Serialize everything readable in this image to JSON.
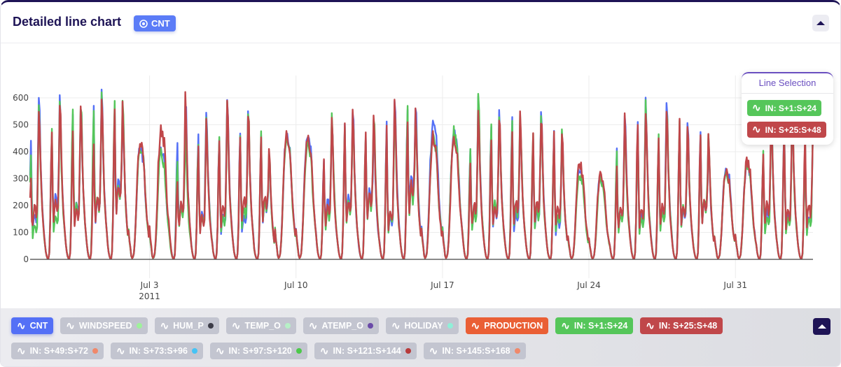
{
  "header": {
    "title": "Detailed line chart",
    "badge": "CNT",
    "badge_icon": "target-icon",
    "collapse_icon": "chevron-up-icon"
  },
  "line_selection": {
    "title": "Line Selection",
    "items": [
      {
        "label": "IN: S+1:S+24",
        "color": "#55c65a"
      },
      {
        "label": "IN: S+25:S+48",
        "color": "#c0474a"
      }
    ]
  },
  "legend": {
    "row1": [
      {
        "label": "CNT",
        "active": true,
        "color": "#5470f6",
        "dot": ""
      },
      {
        "label": "WINDSPEED",
        "active": false,
        "dot": "#9ef29a"
      },
      {
        "label": "HUM_P",
        "active": false,
        "dot": "#3c3c48"
      },
      {
        "label": "TEMP_O",
        "active": false,
        "dot": "#b6f0c6"
      },
      {
        "label": "ATEMP_O",
        "active": false,
        "dot": "#6a4aa8"
      },
      {
        "label": "HOLIDAY",
        "active": false,
        "dot": "#8ff0d8"
      },
      {
        "label": "PRODUCTION",
        "active": true,
        "color": "#ea5f35",
        "dot": ""
      },
      {
        "label": "IN: S+1:S+24",
        "active": true,
        "color": "#55c65a",
        "dot": ""
      },
      {
        "label": "IN: S+25:S+48",
        "active": true,
        "color": "#c0474a",
        "dot": ""
      }
    ],
    "row2": [
      {
        "label": "IN: S+49:S+72",
        "active": false,
        "dot": "#f0886a"
      },
      {
        "label": "IN: S+73:S+96",
        "active": false,
        "dot": "#45c3f5"
      },
      {
        "label": "IN: S+97:S+120",
        "active": false,
        "dot": "#4cc94a"
      },
      {
        "label": "IN: S+121:S+144",
        "active": false,
        "dot": "#b83a3a"
      },
      {
        "label": "IN: S+145:S+168",
        "active": false,
        "dot": "#f0886a"
      }
    ],
    "collapse_icon": "chevron-up-icon"
  },
  "chart_data": {
    "type": "line",
    "x_range": [
      "2011-06-27 07:00",
      "2011-08-03 17:00"
    ],
    "ylim": [
      0,
      640
    ],
    "y_ticks": [
      "0",
      "100",
      "200",
      "300",
      "400",
      "500",
      "600"
    ],
    "x_ticks": [
      {
        "date": "2011-07-03",
        "label": "Jul 3",
        "sub": "2011"
      },
      {
        "date": "2011-07-10",
        "label": "Jul 10",
        "sub": ""
      },
      {
        "date": "2011-07-17",
        "label": "Jul 17",
        "sub": ""
      },
      {
        "date": "2011-07-24",
        "label": "Jul 24",
        "sub": ""
      },
      {
        "date": "2011-07-31",
        "label": "Jul 31",
        "sub": ""
      }
    ],
    "grid": true,
    "sampling": "hourly; daily peaks listed as [morning, midday, evening] for weekdays and [peak] for weekend days",
    "start_day": "2011-06-27",
    "series": [
      {
        "name": "CNT",
        "color": "#5470f6",
        "daily": [
          [
            450,
            165,
            605
          ],
          [
            470,
            230,
            580
          ],
          [
            540,
            220,
            590
          ],
          [
            555,
            230,
            600
          ],
          [
            560,
            290,
            575
          ],
          [
            420
          ],
          [
            415
          ],
          [
            450,
            200,
            600
          ],
          [
            460,
            170,
            550
          ],
          [
            450,
            160,
            600
          ],
          [
            465,
            160,
            560
          ],
          [
            460,
            220,
            400
          ],
          [
            460
          ],
          [
            460
          ],
          [
            370,
            230,
            520
          ],
          [
            480,
            230,
            550
          ],
          [
            470,
            260,
            490
          ],
          [
            490,
            160,
            600
          ],
          [
            575,
            300,
            590
          ],
          [
            505
          ],
          [
            470
          ],
          [
            410,
            190,
            580
          ],
          [
            500,
            200,
            540
          ],
          [
            500,
            170,
            520
          ],
          [
            460,
            180,
            530
          ],
          [
            470,
            150,
            470
          ],
          [
            340
          ],
          [
            310
          ],
          [
            390,
            190,
            545
          ],
          [
            500,
            170,
            570
          ],
          [
            430,
            190,
            580
          ],
          [
            490,
            190,
            485
          ],
          [
            490,
            220,
            450
          ],
          [
            340
          ],
          [
            360
          ],
          [
            380,
            180,
            530
          ],
          [
            500,
            170,
            540
          ],
          [
            430,
            160,
            530
          ]
        ]
      },
      {
        "name": "IN: S+1:S+24",
        "color": "#55c65a",
        "daily": [
          [
            400,
            130,
            560
          ],
          [
            475,
            160,
            560
          ],
          [
            560,
            200,
            575
          ],
          [
            570,
            230,
            590
          ],
          [
            570,
            270,
            570
          ],
          [
            425
          ],
          [
            400
          ],
          [
            380,
            200,
            460
          ],
          [
            440,
            160,
            525
          ],
          [
            450,
            160,
            565
          ],
          [
            465,
            190,
            550
          ],
          [
            450,
            220,
            400
          ],
          [
            450
          ],
          [
            440
          ],
          [
            360,
            180,
            540
          ],
          [
            495,
            210,
            540
          ],
          [
            460,
            230,
            540
          ],
          [
            450,
            170,
            560
          ],
          [
            540,
            270,
            540
          ],
          [
            450
          ],
          [
            470
          ],
          [
            420,
            180,
            590
          ],
          [
            500,
            220,
            530
          ],
          [
            500,
            200,
            530
          ],
          [
            470,
            190,
            520
          ],
          [
            460,
            160,
            460
          ],
          [
            320
          ],
          [
            300
          ],
          [
            380,
            170,
            500
          ],
          [
            500,
            150,
            560
          ],
          [
            440,
            170,
            560
          ],
          [
            500,
            200,
            485
          ],
          [
            470,
            230,
            460
          ],
          [
            330
          ],
          [
            350
          ],
          [
            390,
            160,
            520
          ],
          [
            480,
            150,
            520
          ],
          [
            420,
            150,
            520
          ]
        ]
      },
      {
        "name": "IN: S+25:S+48",
        "color": "#c0474a",
        "daily": [
          [
            300,
            200,
            560
          ],
          [
            470,
            220,
            580
          ],
          [
            470,
            190,
            580
          ],
          [
            440,
            230,
            600
          ],
          [
            560,
            280,
            560
          ],
          [
            440
          ],
          [
            490
          ],
          [
            300,
            210,
            600
          ],
          [
            430,
            160,
            500
          ],
          [
            430,
            200,
            560
          ],
          [
            450,
            230,
            545
          ],
          [
            440,
            240,
            410
          ],
          [
            460
          ],
          [
            465
          ],
          [
            360,
            200,
            520
          ],
          [
            480,
            220,
            545
          ],
          [
            460,
            250,
            540
          ],
          [
            470,
            180,
            580
          ],
          [
            520,
            280,
            545
          ],
          [
            450
          ],
          [
            440
          ],
          [
            350,
            210,
            550
          ],
          [
            450,
            200,
            530
          ],
          [
            460,
            220,
            520
          ],
          [
            480,
            220,
            530
          ],
          [
            460,
            200,
            470
          ],
          [
            360
          ],
          [
            320
          ],
          [
            330,
            200,
            540
          ],
          [
            520,
            190,
            530
          ],
          [
            470,
            200,
            540
          ],
          [
            500,
            200,
            480
          ],
          [
            470,
            220,
            450
          ],
          [
            330
          ],
          [
            370
          ],
          [
            410,
            210,
            520
          ],
          [
            500,
            190,
            540
          ],
          [
            470,
            200,
            520
          ]
        ]
      }
    ]
  }
}
